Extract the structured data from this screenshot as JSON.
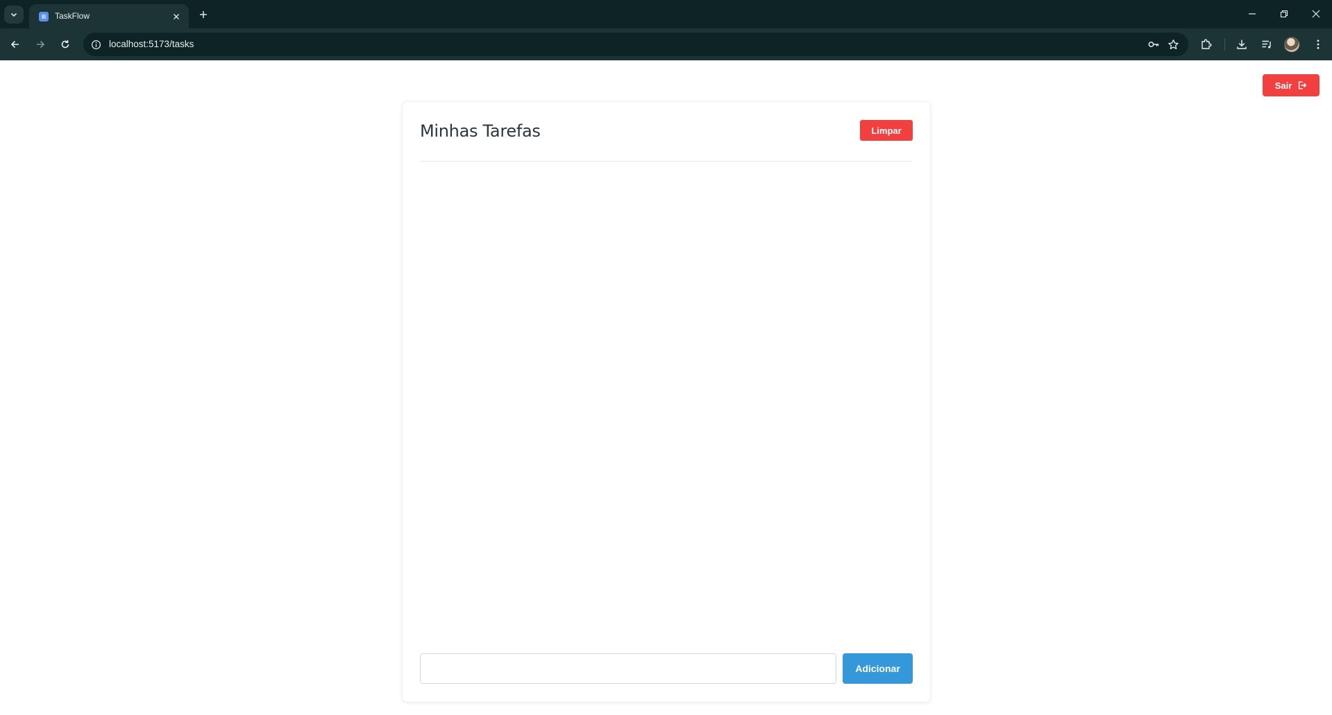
{
  "browser": {
    "tab": {
      "title": "TaskFlow"
    },
    "address_bar": {
      "url": "localhost:5173/tasks"
    },
    "icons": [
      "tab-search-icon",
      "close-icon",
      "plus-icon",
      "minimize-icon",
      "restore-icon",
      "close-window-icon",
      "back-arrow-icon",
      "forward-arrow-icon",
      "reload-icon",
      "site-info-icon",
      "password-key-icon",
      "bookmark-star-icon",
      "extensions-icon",
      "download-icon",
      "media-control-icon",
      "kebab-menu-icon"
    ]
  },
  "header": {
    "logout_label": "Sair",
    "logout_icon": "logout-icon"
  },
  "tasks_card": {
    "title": "Minhas Tarefas",
    "clear_label": "Limpar",
    "tasks": [],
    "input": {
      "value": "",
      "placeholder": ""
    },
    "add_label": "Adicionar"
  },
  "colors": {
    "danger": "#f23f3f",
    "primary": "#3498db",
    "chrome_dark": "#0d2325",
    "chrome_toolbar": "#1c3436"
  }
}
